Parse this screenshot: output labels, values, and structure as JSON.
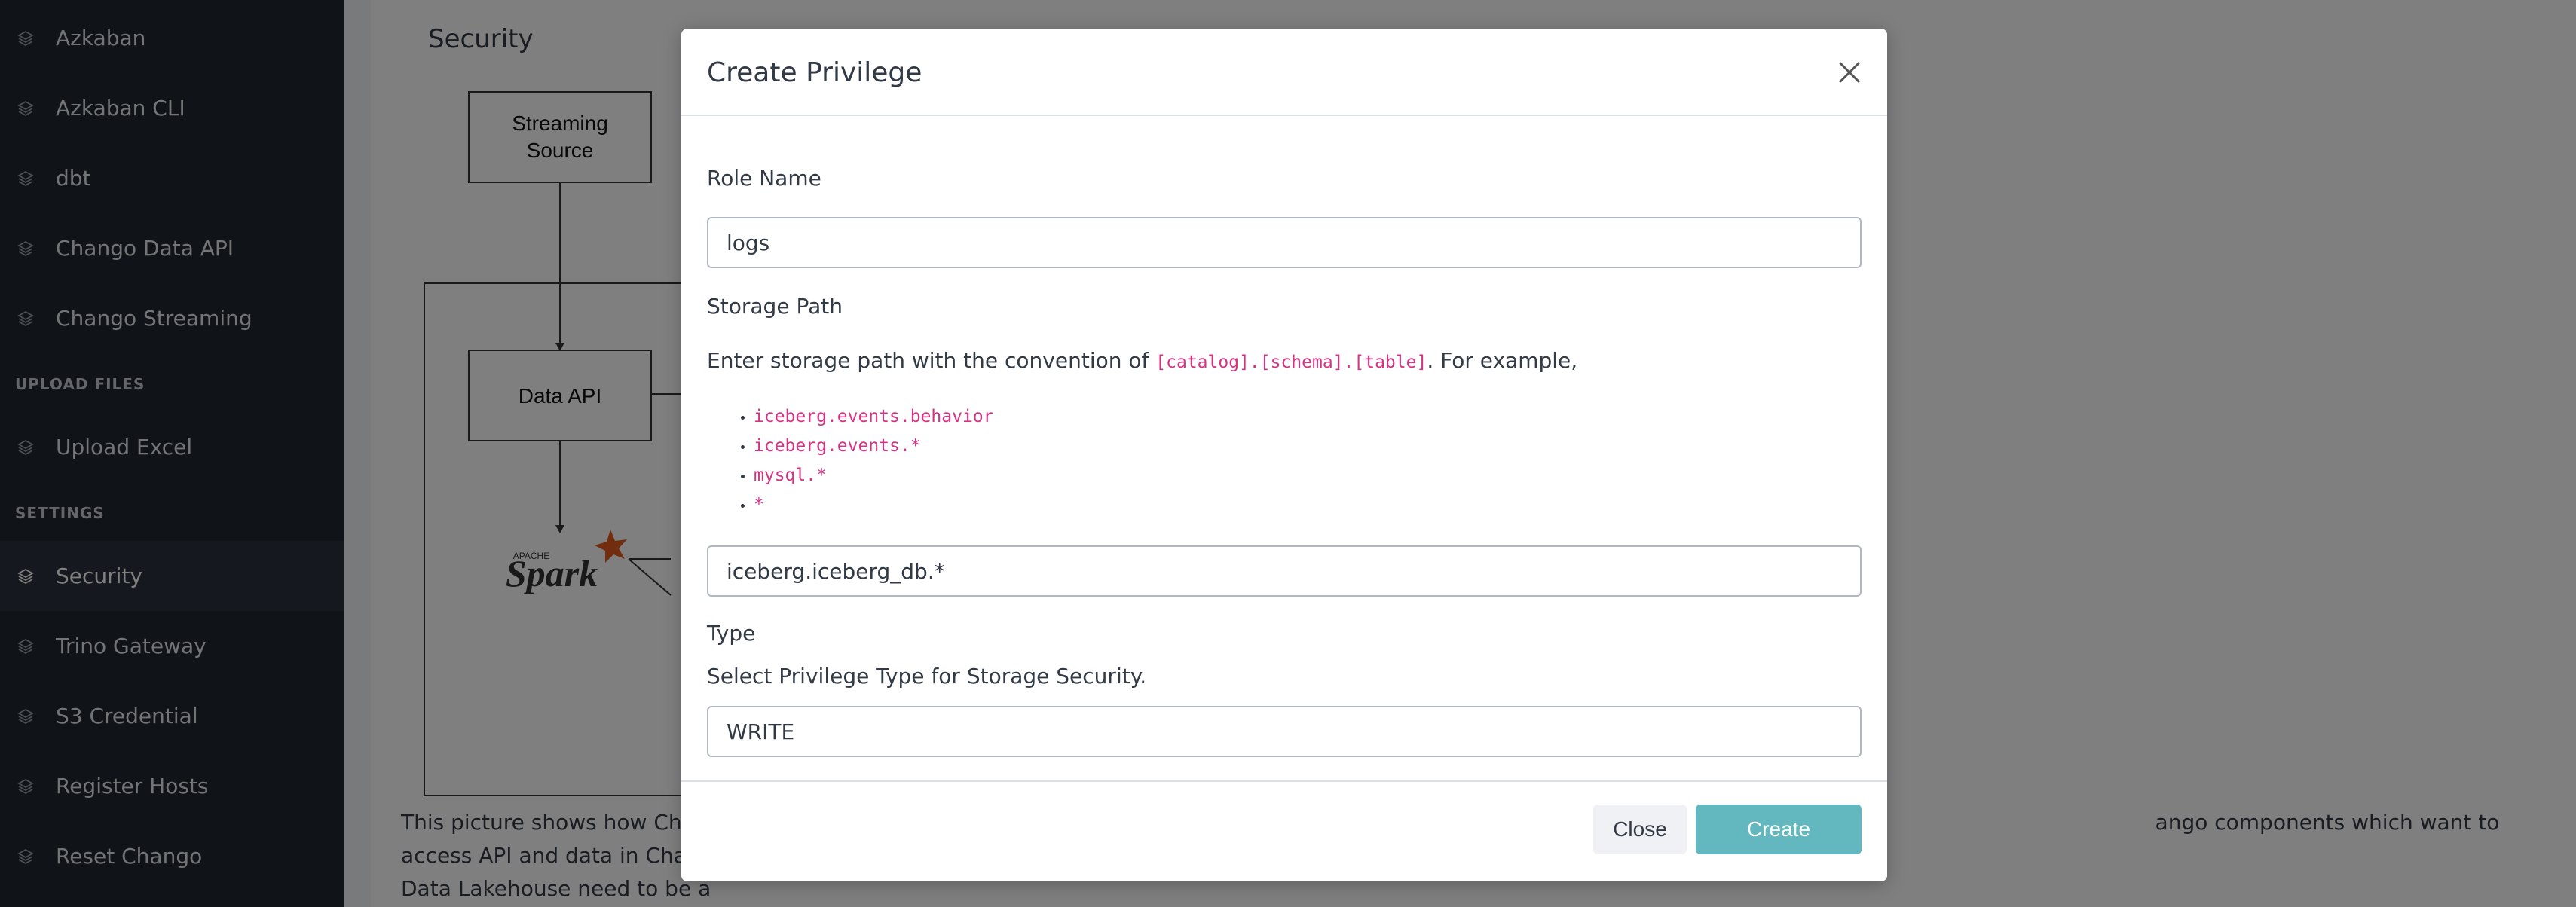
{
  "sidebar": {
    "items": [
      {
        "label": "Azkaban",
        "icon": "layers-icon"
      },
      {
        "label": "Azkaban CLI",
        "icon": "layers-icon"
      },
      {
        "label": "dbt",
        "icon": "layers-icon"
      },
      {
        "label": "Chango Data API",
        "icon": "layers-icon"
      },
      {
        "label": "Chango Streaming",
        "icon": "layers-icon"
      }
    ],
    "section_upload": "UPLOAD FILES",
    "upload_items": [
      {
        "label": "Upload Excel",
        "icon": "layers-icon"
      }
    ],
    "section_settings": "SETTINGS",
    "settings_items": [
      {
        "label": "Security",
        "icon": "layers-icon",
        "active": true
      },
      {
        "label": "Trino Gateway",
        "icon": "layers-icon"
      },
      {
        "label": "S3 Credential",
        "icon": "layers-icon"
      },
      {
        "label": "Register Hosts",
        "icon": "layers-icon"
      },
      {
        "label": "Reset Chango",
        "icon": "layers-icon"
      }
    ]
  },
  "page": {
    "title": "Security",
    "diagram": {
      "streaming_source_line1": "Streaming",
      "streaming_source_line2": "Source",
      "data_api": "Data API",
      "spark_small": "APACHE",
      "spark": "Spark"
    },
    "description_line1": "This picture shows how Chan",
    "description_line1b": "ango components which want to access API and data in Chango",
    "description_line2": "Data Lakehouse need to be a"
  },
  "modal": {
    "title": "Create Privilege",
    "role_name_label": "Role Name",
    "role_name_value": "logs",
    "storage_path_label": "Storage Path",
    "storage_path_help_prefix": "Enter storage path with the convention of ",
    "storage_path_help_code": "[catalog].[schema].[table]",
    "storage_path_help_suffix": ". For example,",
    "examples": [
      "iceberg.events.behavior",
      "iceberg.events.*",
      "mysql.*",
      "*"
    ],
    "storage_path_value": "iceberg.iceberg_db.*",
    "type_label": "Type",
    "type_help": "Select Privilege Type for Storage Security.",
    "type_value": "WRITE",
    "close_label": "Close",
    "create_label": "Create"
  },
  "colors": {
    "sidebar_bg": "#212631",
    "accent": "#63b7be",
    "code": "#d63384"
  }
}
